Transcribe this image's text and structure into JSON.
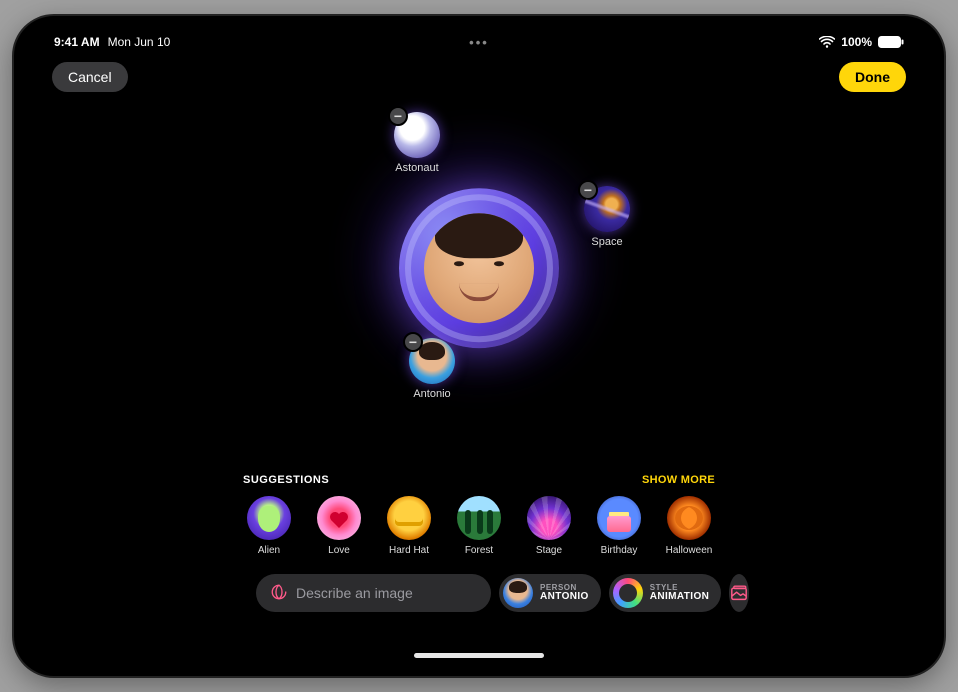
{
  "status": {
    "time": "9:41 AM",
    "date": "Mon Jun 10",
    "battery_pct": "100%"
  },
  "top": {
    "cancel_label": "Cancel",
    "done_label": "Done"
  },
  "orbit": {
    "astronaut_label": "Astonaut",
    "space_label": "Space",
    "antonio_label": "Antonio"
  },
  "suggestions": {
    "title": "SUGGESTIONS",
    "show_more": "SHOW MORE",
    "items": [
      {
        "label": "Alien"
      },
      {
        "label": "Love"
      },
      {
        "label": "Hard Hat"
      },
      {
        "label": "Forest"
      },
      {
        "label": "Stage"
      },
      {
        "label": "Birthday"
      },
      {
        "label": "Halloween"
      }
    ]
  },
  "prompt": {
    "placeholder": "Describe an image",
    "person_cat": "PERSON",
    "person_val": "ANTONIO",
    "style_cat": "STYLE",
    "style_val": "ANIMATION"
  }
}
